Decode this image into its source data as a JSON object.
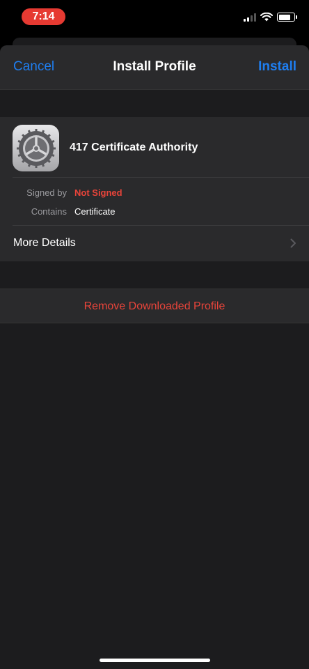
{
  "status": {
    "time": "7:14",
    "time_pill_color": "#e63a32",
    "icons": [
      "cellular-signal-icon",
      "wifi-icon",
      "battery-icon"
    ]
  },
  "nav": {
    "cancel_label": "Cancel",
    "title": "Install Profile",
    "install_label": "Install",
    "accent_color": "#1f7ef0"
  },
  "profile": {
    "icon": "settings-gear-icon",
    "name": "417 Certificate Authority",
    "details": [
      {
        "label": "Signed by",
        "value": "Not Signed"
      },
      {
        "label": "Contains",
        "value": "Certificate"
      }
    ],
    "more_label": "More Details",
    "warning_color": "#e8443a"
  },
  "actions": {
    "remove_label": "Remove Downloaded Profile"
  }
}
